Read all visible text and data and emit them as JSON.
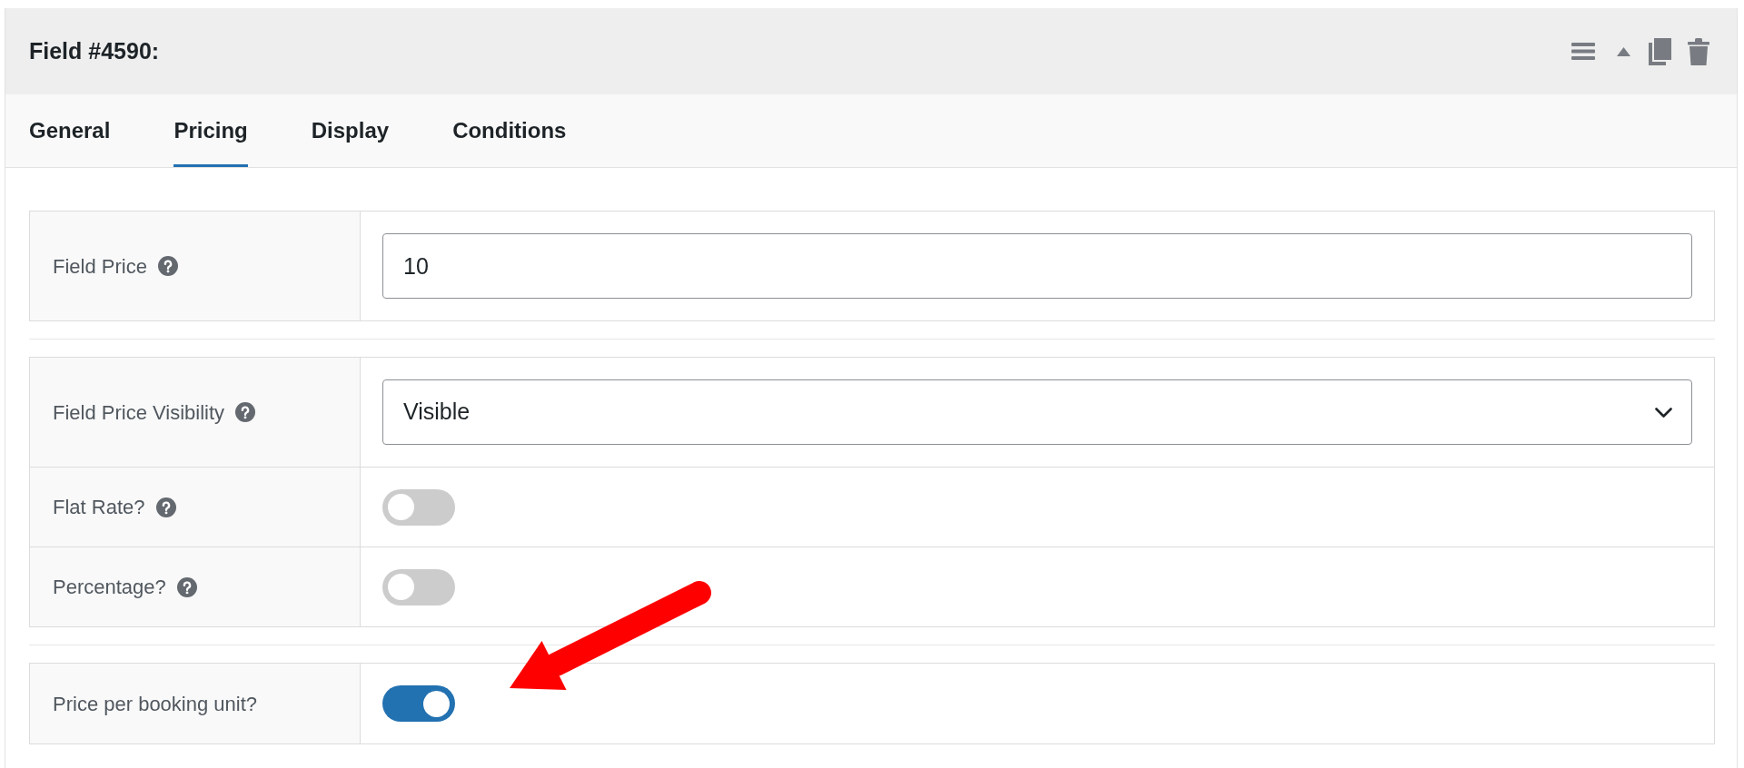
{
  "panel": {
    "title": "Field #4590:"
  },
  "tabs": [
    {
      "label": "General",
      "selected": false
    },
    {
      "label": "Pricing",
      "selected": true
    },
    {
      "label": "Display",
      "selected": false
    },
    {
      "label": "Conditions",
      "selected": false
    }
  ],
  "groups": [
    {
      "rows": [
        {
          "kind": "text",
          "label": "Field Price",
          "help": true,
          "value": "10",
          "arrow": false
        }
      ]
    },
    {
      "rows": [
        {
          "kind": "select",
          "label": "Field Price Visibility",
          "help": true,
          "value": "Visible",
          "arrow": false
        },
        {
          "kind": "toggle",
          "label": "Flat Rate?",
          "help": true,
          "on": false,
          "arrow": false
        },
        {
          "kind": "toggle",
          "label": "Percentage?",
          "help": true,
          "on": false,
          "arrow": false
        }
      ]
    },
    {
      "rows": [
        {
          "kind": "toggle",
          "label": "Price per booking unit?",
          "help": false,
          "on": true,
          "arrow": true
        }
      ]
    }
  ]
}
